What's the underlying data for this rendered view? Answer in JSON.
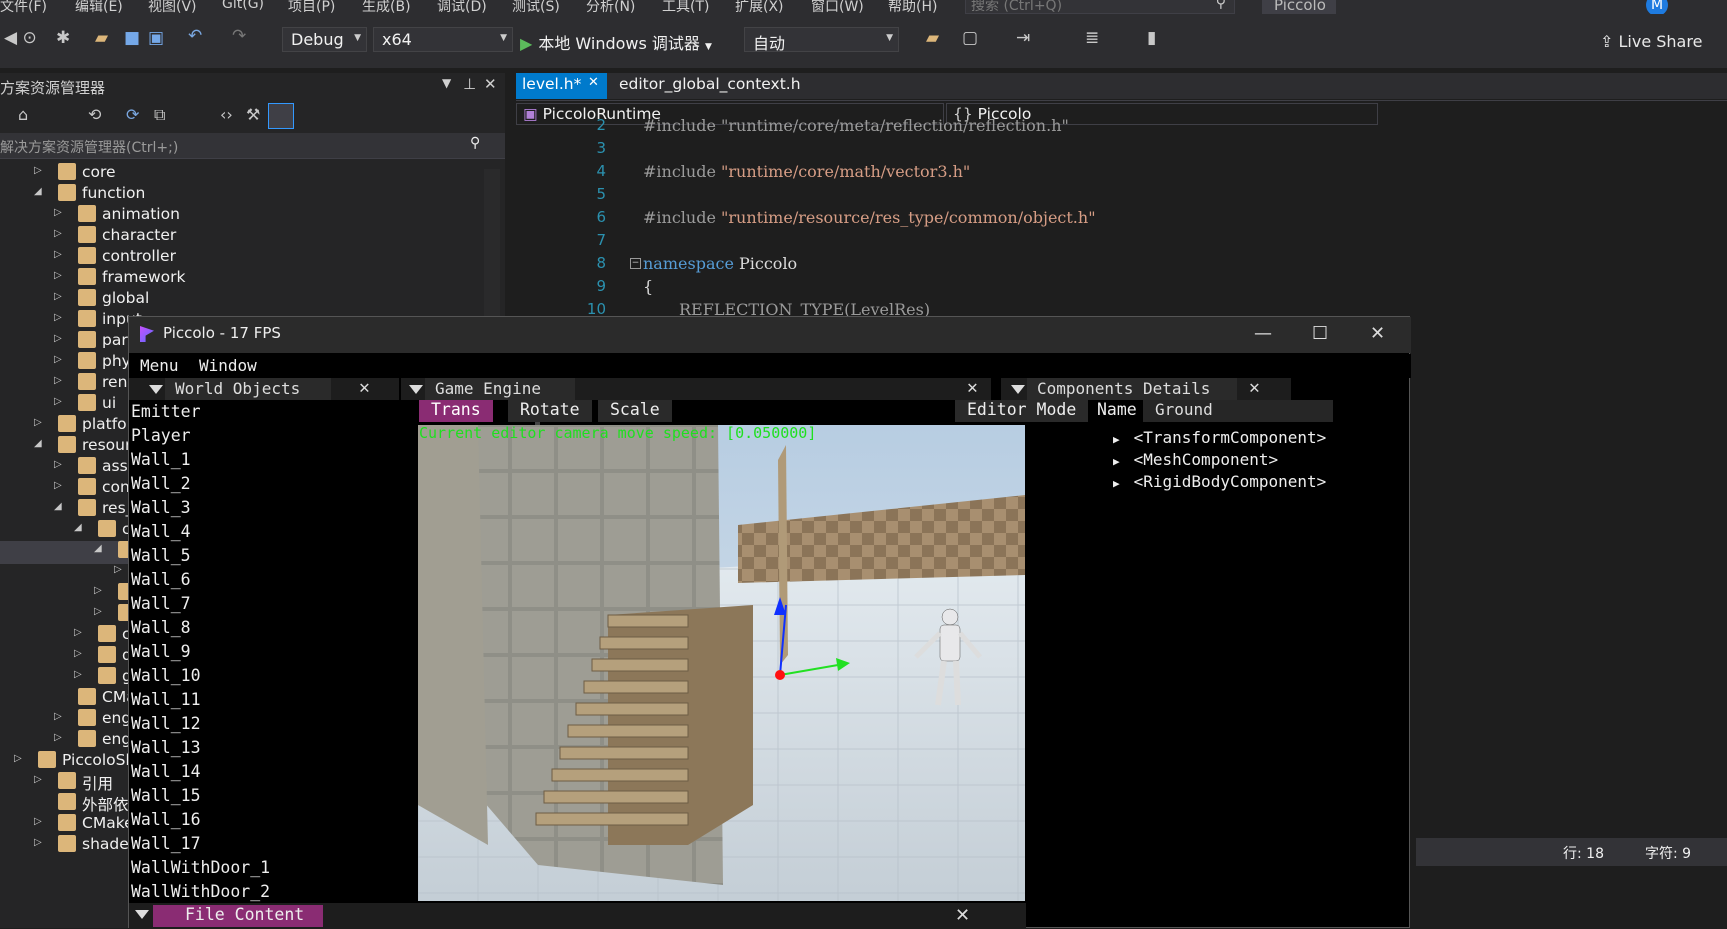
{
  "vs": {
    "menu": [
      "文件(F)",
      "编辑(E)",
      "视图(V)",
      "Git(G)",
      "项目(P)",
      "生成(B)",
      "调试(D)",
      "测试(S)",
      "分析(N)",
      "工具(T)",
      "扩展(X)",
      "窗口(W)",
      "帮助(H)"
    ],
    "search_placeholder": "搜索 (Ctrl+Q)",
    "app_name": "Piccolo",
    "avatar": "M",
    "toolbar": {
      "config": "Debug",
      "platform": "x64",
      "run_label": "本地 Windows 调试器",
      "run_mode": "自动",
      "live_share": "Live Share"
    },
    "colors": {
      "accent": "#007acc",
      "piccolo_accent": "#8a2c73",
      "camera_text": "#1fe01f"
    }
  },
  "solution_explorer": {
    "title": "方案资源管理器",
    "search_placeholder": "解决方案资源管理器(Ctrl+;)",
    "tree": [
      {
        "label": "core",
        "exp": "▷"
      },
      {
        "label": "function",
        "exp": "◢"
      },
      {
        "label": "animation",
        "exp": "▷"
      },
      {
        "label": "character",
        "exp": "▷"
      },
      {
        "label": "controller",
        "exp": "▷"
      },
      {
        "label": "framework",
        "exp": "▷"
      },
      {
        "label": "global",
        "exp": "▷"
      },
      {
        "label": "input",
        "exp": "▷"
      },
      {
        "label": "partic",
        "exp": "▷"
      },
      {
        "label": "physi",
        "exp": "▷"
      },
      {
        "label": "rende",
        "exp": "▷"
      },
      {
        "label": "ui",
        "exp": "▷"
      },
      {
        "label": "platform",
        "exp": "▷"
      },
      {
        "label": "resource",
        "exp": "◢"
      },
      {
        "label": "asset",
        "exp": "▷"
      },
      {
        "label": "confi",
        "exp": "▷"
      },
      {
        "label": "res_t",
        "exp": "◢"
      },
      {
        "label": "co",
        "exp": "◢"
      },
      {
        "label": "",
        "exp": "◢"
      },
      {
        "label": "",
        "exp": "▷"
      },
      {
        "label": "",
        "exp": "▷"
      },
      {
        "label": "",
        "exp": "▷"
      },
      {
        "label": "co",
        "exp": "▷"
      },
      {
        "label": "da",
        "exp": "▷"
      },
      {
        "label": "gl",
        "exp": "▷"
      },
      {
        "label": "CMakeL",
        "exp": ""
      },
      {
        "label": "engine.c",
        "exp": "▷"
      },
      {
        "label": "engine.h",
        "exp": "▷"
      },
      {
        "label": "PiccoloSha",
        "exp": "▷"
      },
      {
        "label": "引用",
        "exp": "▷"
      },
      {
        "label": "外部依赖",
        "exp": ""
      },
      {
        "label": "CMake F",
        "exp": "▷"
      },
      {
        "label": "shaders",
        "exp": "▷"
      }
    ]
  },
  "editor": {
    "tabs": [
      "level.h*",
      "editor_global_context.h"
    ],
    "nav_project": "PiccoloRuntime",
    "nav_scope": "Piccolo",
    "lines": [
      {
        "n": "2",
        "text": "#include \"runtime/core/meta/reflection/reflection.h\""
      },
      {
        "n": "3",
        "text": ""
      },
      {
        "n": "4",
        "text": "#include \"runtime/core/math/vector3.h\""
      },
      {
        "n": "5",
        "text": ""
      },
      {
        "n": "6",
        "text": "#include \"runtime/resource/res_type/common/object.h\""
      },
      {
        "n": "7",
        "text": ""
      },
      {
        "n": "8",
        "text": "namespace Piccolo"
      },
      {
        "n": "9",
        "text": "{"
      },
      {
        "n": "10",
        "text": "REFLECTION_TYPE(LevelRes)"
      }
    ],
    "status_line": "行: 18",
    "status_char": "字符: 9"
  },
  "piccolo": {
    "title": "Piccolo - 17 FPS",
    "menu": [
      "Menu",
      "Window"
    ],
    "world_objects_title": "World Objects",
    "game_engine_title": "Game Engine",
    "components_title": "Components Details",
    "file_content_title": "File Content",
    "mode_buttons": [
      "Trans",
      "Rotate",
      "Scale"
    ],
    "editor_mode": "Editor Mode",
    "camera_speed": "Current editor camera move speed: [0.050000]",
    "objects": [
      "Emitter",
      "Player",
      "Wall_1",
      "Wall_2",
      "Wall_3",
      "Wall_4",
      "Wall_5",
      "Wall_6",
      "Wall_7",
      "Wall_8",
      "Wall_9",
      "Wall_10",
      "Wall_11",
      "Wall_12",
      "Wall_13",
      "Wall_14",
      "Wall_15",
      "Wall_16",
      "Wall_17",
      "WallWithDoor_1",
      "WallWithDoor_2"
    ],
    "name_label": "Name",
    "name_value": "Ground",
    "components": [
      "<TransformComponent>",
      "<MeshComponent>",
      "<RigidBodyComponent>"
    ]
  }
}
